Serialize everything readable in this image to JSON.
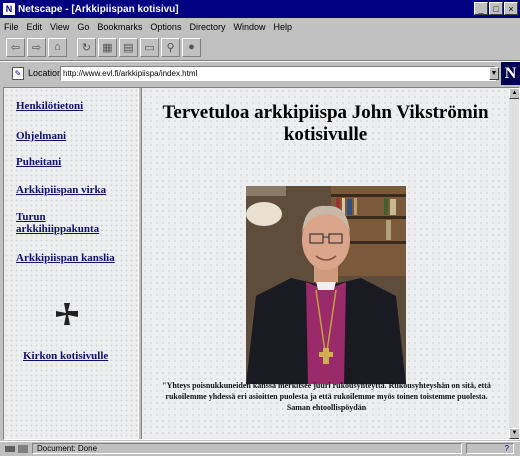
{
  "window": {
    "title": "Netscape - [Arkkipiispan kotisivu]",
    "controls": [
      "_",
      "□",
      "×"
    ]
  },
  "menu": [
    "File",
    "Edit",
    "View",
    "Go",
    "Bookmarks",
    "Options",
    "Directory",
    "Window",
    "Help"
  ],
  "toolbar": {
    "icons": [
      "back-icon",
      "forward-icon",
      "home-icon",
      "reload-icon",
      "images-icon",
      "open-icon",
      "print-icon",
      "find-icon",
      "stop-icon"
    ]
  },
  "location": {
    "label": "Location:",
    "url": "http://www.evl.fi/arkkipiispa/index.html"
  },
  "logo": "N",
  "nav": {
    "items": [
      "Henkilötietoni",
      "Ohjelmani",
      "Puheitani",
      "Arkkipiispan virka",
      "Turun arkkihiippakunta",
      "Arkkipiispan kanslia"
    ],
    "church_link": "Kirkon kotisivulle"
  },
  "main": {
    "title": "Tervetuloa arkkipiispa John Vikströmin kotisivulle",
    "quote": "\"Yhteys poisnukkuneiden kanssa merkitsee juuri rukousyhteyttä. Rukousyhteyshän on sitä, että rukoilemme yhdessä eri asioitten puolesta ja että rukoilemme myös toinen toistemme puolesta. Saman ehtoollispöydän"
  },
  "status": {
    "text": "Document: Done",
    "right": "?"
  }
}
